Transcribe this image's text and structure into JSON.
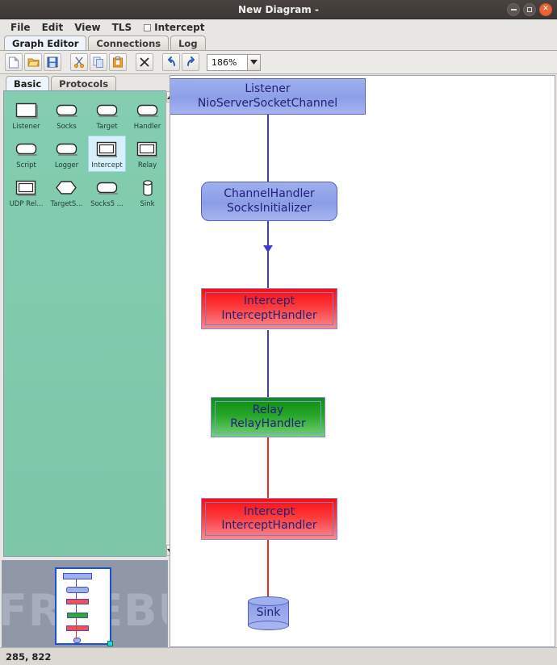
{
  "window": {
    "title": "New Diagram -",
    "controls": [
      {
        "name": "minimize",
        "glyph": "–"
      },
      {
        "name": "maximize",
        "glyph": "□"
      },
      {
        "name": "close",
        "glyph": "×"
      }
    ]
  },
  "menubar": {
    "items": [
      "File",
      "Edit",
      "View",
      "TLS"
    ],
    "intercept": {
      "label": "Intercept",
      "checked": false
    }
  },
  "tabs": {
    "items": [
      "Graph Editor",
      "Connections",
      "Log"
    ],
    "active": "Graph Editor"
  },
  "toolbar": {
    "buttons": [
      {
        "name": "new-file-icon",
        "title": "New"
      },
      {
        "name": "open-folder-icon",
        "title": "Open"
      },
      {
        "name": "save-icon",
        "title": "Save"
      },
      {
        "name": "cut-icon",
        "title": "Cut"
      },
      {
        "name": "copy-icon",
        "title": "Copy"
      },
      {
        "name": "paste-icon",
        "title": "Paste"
      },
      {
        "name": "delete-icon",
        "title": "Delete"
      },
      {
        "name": "undo-icon",
        "title": "Undo"
      },
      {
        "name": "redo-icon",
        "title": "Redo"
      }
    ],
    "zoom": {
      "value": "186%",
      "arrow": "▼"
    }
  },
  "palette": {
    "tabs": [
      "Basic",
      "Protocols"
    ],
    "active_tab": "Basic",
    "selected_item": "Intercept",
    "items": [
      {
        "label": "Listener",
        "shape": "rect"
      },
      {
        "label": "Socks",
        "shape": "rounded"
      },
      {
        "label": "Target",
        "shape": "rounded"
      },
      {
        "label": "Handler",
        "shape": "rounded"
      },
      {
        "label": "Script",
        "shape": "rounded"
      },
      {
        "label": "Logger",
        "shape": "rounded"
      },
      {
        "label": "Intercept",
        "shape": "double-rect"
      },
      {
        "label": "Relay",
        "shape": "double-rect"
      },
      {
        "label": "UDP Rel...",
        "shape": "double-rect"
      },
      {
        "label": "TargetS...",
        "shape": "hexagon"
      },
      {
        "label": "Socks5 ...",
        "shape": "rounded"
      },
      {
        "label": "Sink",
        "shape": "cylinder"
      }
    ],
    "scroll_up": "▲",
    "scroll_down": "▼"
  },
  "outline": {
    "watermark": "FREEBUF"
  },
  "diagram": {
    "nodes": [
      {
        "id": "listener",
        "type": "listener",
        "line1": "Listener",
        "line2": "NioServerSocketChannel"
      },
      {
        "id": "channel",
        "type": "rounded",
        "line1": "ChannelHandler",
        "line2": "SocksInitializer"
      },
      {
        "id": "intercept1",
        "type": "intercept",
        "line1": "Intercept",
        "line2": "InterceptHandler"
      },
      {
        "id": "relay",
        "type": "relay",
        "line1": "Relay",
        "line2": "RelayHandler"
      },
      {
        "id": "intercept2",
        "type": "intercept",
        "line1": "Intercept",
        "line2": "InterceptHandler"
      },
      {
        "id": "sink",
        "type": "cylinder",
        "line1": "Sink",
        "line2": ""
      }
    ],
    "edges": [
      {
        "from": "listener",
        "to": "channel",
        "color": "blue"
      },
      {
        "from": "channel",
        "to": "intercept1",
        "color": "blue"
      },
      {
        "from": "intercept1",
        "to": "relay",
        "color": "blue"
      },
      {
        "from": "relay",
        "to": "intercept2",
        "color": "red"
      },
      {
        "from": "intercept2",
        "to": "sink",
        "color": "red"
      }
    ],
    "colors": {
      "listener_fill": "#8d9fe8",
      "intercept_fill": "#fc0c10",
      "relay_fill": "#0f8c12",
      "edge_blue": "#3b3bcf",
      "edge_red": "#f5271f",
      "label_text": "#21217a"
    }
  },
  "statusbar": {
    "coordinates": "285, 822"
  }
}
